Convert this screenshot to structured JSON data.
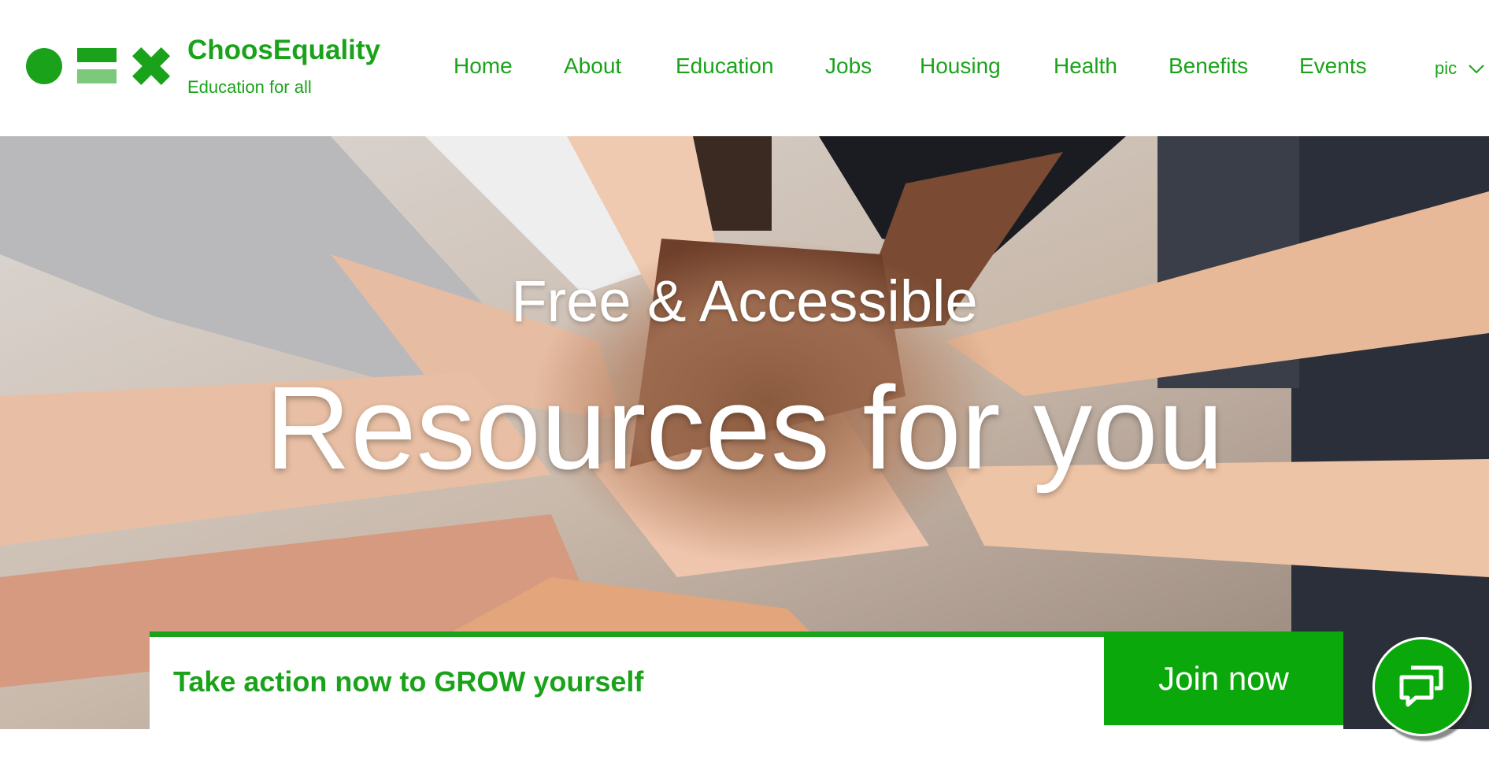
{
  "brand": {
    "name": "ChoosEquality",
    "tagline": "Education for all",
    "color": "#1aa31a"
  },
  "nav": {
    "items": [
      "Home",
      "About",
      "Education",
      "Jobs",
      "Housing",
      "Health",
      "Benefits",
      "Events"
    ]
  },
  "user_menu": {
    "label": "pic",
    "icon": "chevron-down-icon"
  },
  "hero": {
    "subtitle": "Free & Accessible",
    "title": "Resources for you"
  },
  "cta": {
    "text": "Take action now to GROW yourself",
    "button_label": "Join now",
    "button_color": "#0aa80a"
  },
  "chat": {
    "icon": "chat-bubbles-icon"
  }
}
